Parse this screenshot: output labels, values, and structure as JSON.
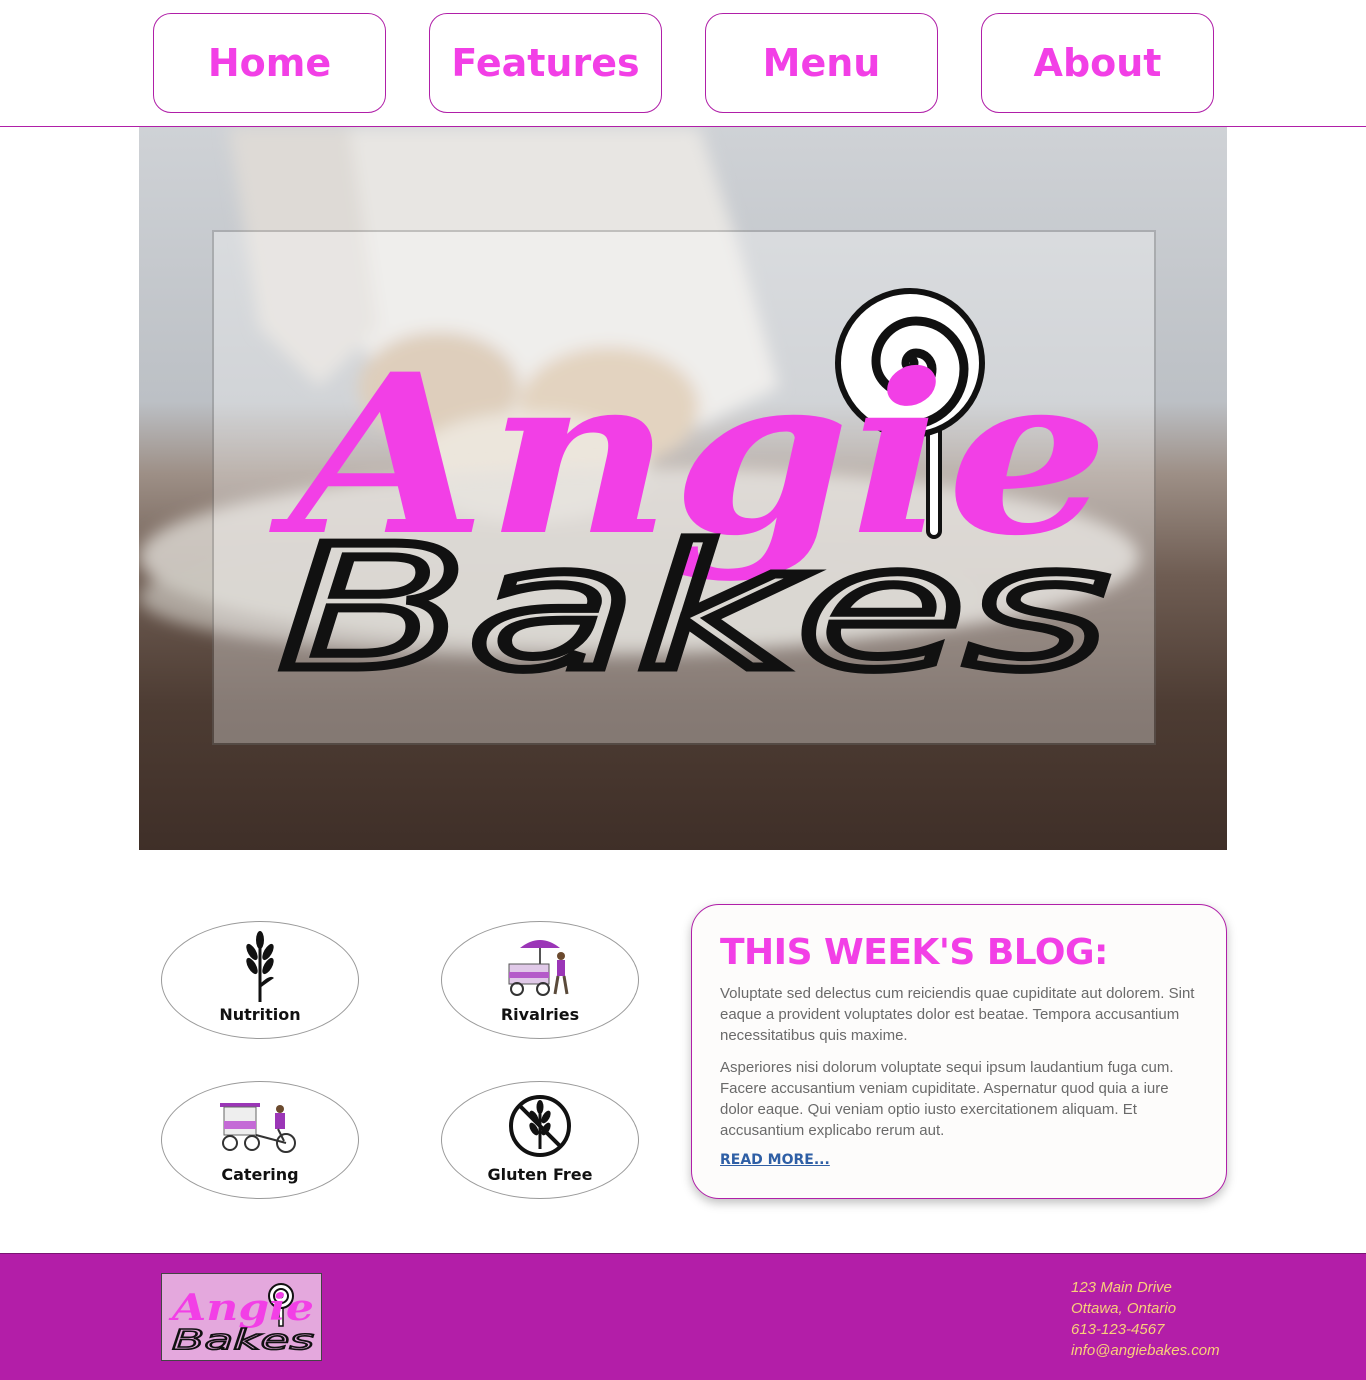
{
  "nav": {
    "items": [
      {
        "label": "Home"
      },
      {
        "label": "Features"
      },
      {
        "label": "Menu"
      },
      {
        "label": "About"
      }
    ]
  },
  "hero": {
    "logo_top": "Angie",
    "logo_bottom": "Bakes",
    "logo_icon": "lollipop-icon"
  },
  "features": [
    {
      "label": "Nutrition",
      "icon": "wheat-icon"
    },
    {
      "label": "Rivalries",
      "icon": "food-cart-icon"
    },
    {
      "label": "Catering",
      "icon": "catering-bike-icon"
    },
    {
      "label": "Gluten Free",
      "icon": "no-gluten-icon"
    }
  ],
  "blog": {
    "heading": "THIS WEEK'S BLOG:",
    "paragraph_1": "Voluptate sed delectus cum reiciendis quae cupiditate aut dolorem. Sint eaque a provident voluptates dolor est beatae. Tempora accusantium necessitatibus quis maxime.",
    "paragraph_2": "Asperiores nisi dolorum voluptate sequi ipsum laudantium fuga cum. Facere accusantium veniam cupiditate. Aspernatur quod quia a iure dolor eaque. Qui veniam optio iusto exercitationem aliquam. Et accusantium explicabo rerum aut.",
    "read_more": "READ MORE..."
  },
  "footer": {
    "logo_top": "Angie",
    "logo_bottom": "Bakes",
    "address_line_1": "123 Main Drive",
    "address_line_2": "Ottawa, Ontario",
    "phone": "613-123-4567",
    "email": "info@angiebakes.com"
  },
  "colors": {
    "brand_pink": "#f23fe6",
    "border_purple": "#b01fa8",
    "footer_bg": "#b31ea8",
    "footer_text": "#f9d07a",
    "link_blue": "#2f5fa5"
  }
}
